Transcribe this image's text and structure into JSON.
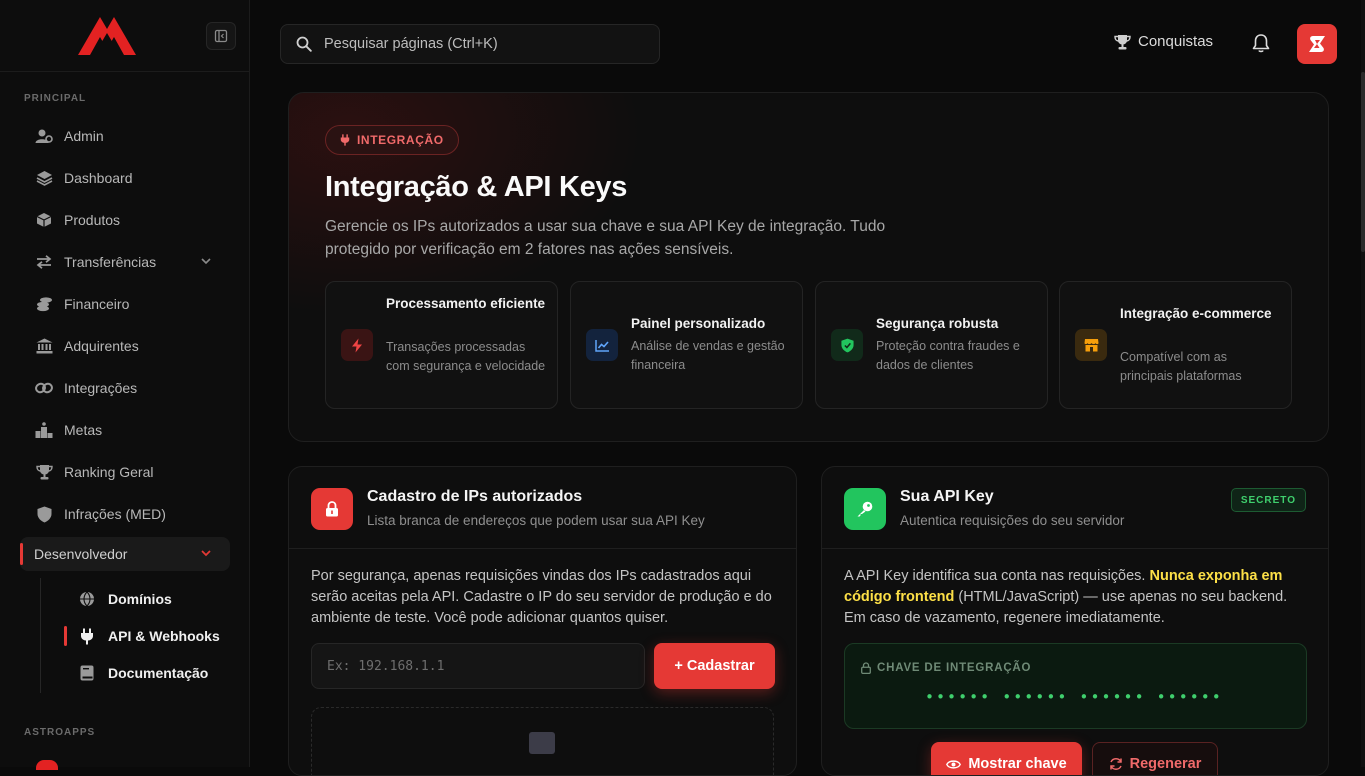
{
  "sidebar": {
    "section_principal": "PRINCIPAL",
    "section_astroapps": "ASTROAPPS",
    "items": [
      {
        "label": "Admin",
        "icon": "users-gear-icon"
      },
      {
        "label": "Dashboard",
        "icon": "layers-icon"
      },
      {
        "label": "Produtos",
        "icon": "box-icon"
      },
      {
        "label": "Transferências",
        "icon": "arrows-exchange-icon"
      },
      {
        "label": "Financeiro",
        "icon": "coins-icon"
      },
      {
        "label": "Adquirentes",
        "icon": "bank-icon"
      },
      {
        "label": "Integrações",
        "icon": "link-icon"
      },
      {
        "label": "Metas",
        "icon": "podium-icon"
      },
      {
        "label": "Ranking Geral",
        "icon": "trophy-icon"
      },
      {
        "label": "Infrações (MED)",
        "icon": "shield-icon"
      },
      {
        "label": "Desenvolvedor",
        "icon": "chevron-down-icon"
      }
    ],
    "subitems": [
      {
        "label": "Domínios",
        "icon": "globe-icon"
      },
      {
        "label": "API & Webhooks",
        "icon": "plug-icon"
      },
      {
        "label": "Documentação",
        "icon": "book-icon"
      }
    ]
  },
  "topbar": {
    "search_placeholder": "Pesquisar páginas (Ctrl+K)",
    "conquistas": "Conquistas"
  },
  "hero": {
    "badge": "INTEGRAÇÃO",
    "title": "Integração & API Keys",
    "description": "Gerencie os IPs autorizados a usar sua chave e sua API Key de integração. Tudo protegido por verificação em 2 fatores nas ações sensíveis.",
    "features": [
      {
        "title": "Processamento eficiente",
        "desc": "Transações processadas com segurança e velocidade",
        "icon": "bolt-icon",
        "color": "#e53935"
      },
      {
        "title": "Painel personalizado",
        "desc": "Análise de vendas e gestão financeira",
        "icon": "chart-line-icon",
        "color": "#3b82f6"
      },
      {
        "title": "Segurança robusta",
        "desc": "Proteção contra fraudes e dados de clientes",
        "icon": "shield-check-icon",
        "color": "#22c55e"
      },
      {
        "title": "Integração e-commerce",
        "desc": "Compatível com as principais plataformas",
        "icon": "store-icon",
        "color": "#f59e0b"
      }
    ]
  },
  "ip_card": {
    "title": "Cadastro de IPs autorizados",
    "subtitle": "Lista branca de endereços que podem usar sua API Key",
    "body": "Por segurança, apenas requisições vindas dos IPs cadastrados aqui serão aceitas pela API. Cadastre o IP do seu servidor de produção e do ambiente de teste. Você pode adicionar quantos quiser.",
    "input_placeholder": "Ex: 192.168.1.1",
    "button": "+ Cadastrar"
  },
  "api_card": {
    "title": "Sua API Key",
    "subtitle": "Autentica requisições do seu servidor",
    "badge": "SECRETO",
    "body_start": "A API Key identifica sua conta nas requisições.",
    "body_highlight": "Nunca exponha em código frontend",
    "body_end": "(HTML/JavaScript) — use apenas no seu backend. Em caso de vazamento, regenere imediatamente.",
    "key_label": "CHAVE DE INTEGRAÇÃO",
    "key_value": "•••••• •••••• •••••• ••••••",
    "show_button": "Mostrar chave",
    "regen_button": "Regenerar"
  }
}
